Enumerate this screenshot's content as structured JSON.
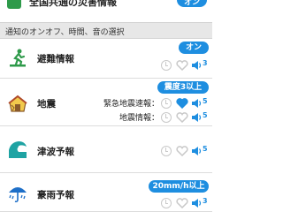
{
  "top": {
    "label": "全国共通の災害情報",
    "toggle": "オン"
  },
  "section": {
    "title": "通知のオンオフ、時間、音の選択"
  },
  "items": [
    {
      "title": "避難情報",
      "pill": "オン",
      "volume": "3",
      "icon": "evacuation-icon",
      "heart_active": false
    },
    {
      "title": "地震",
      "pill": "震度3以上",
      "icon": "earthquake-icon",
      "subrows": [
        {
          "label": "緊急地震速報：",
          "volume": "5",
          "heart_active": true
        },
        {
          "label": "地震情報：",
          "volume": "5",
          "heart_active": false
        }
      ]
    },
    {
      "title": "津波予報",
      "volume": "5",
      "icon": "tsunami-icon",
      "heart_active": false
    },
    {
      "title": "豪雨予報",
      "pill": "20mm/h以上",
      "volume": "3",
      "icon": "heavy-rain-icon",
      "heart_active": false
    }
  ],
  "colors": {
    "accent": "#1e8ee0",
    "icon_green": "#2e9a4a",
    "muted": "#c9c9c9",
    "section_bg": "#e7e7e7"
  }
}
